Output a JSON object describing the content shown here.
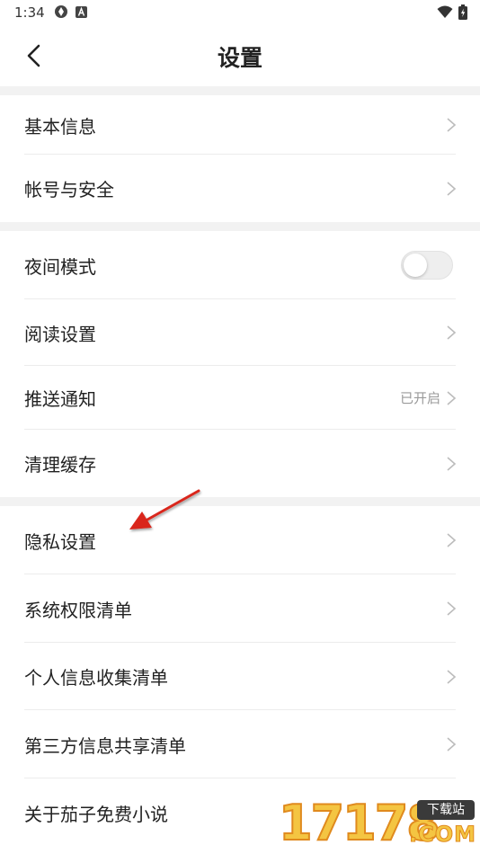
{
  "status_bar": {
    "time": "1:34",
    "icons": [
      "sync-icon",
      "a-badge-icon",
      "wifi-icon",
      "battery-icon"
    ]
  },
  "header": {
    "title": "设置",
    "back_icon": "chevron-left-icon"
  },
  "groups": [
    {
      "items": [
        {
          "label": "基本信息",
          "control": "chevron"
        },
        {
          "label": "帐号与安全",
          "control": "chevron"
        }
      ]
    },
    {
      "items": [
        {
          "label": "夜间模式",
          "control": "toggle",
          "toggle_on": false
        },
        {
          "label": "阅读设置",
          "control": "chevron"
        },
        {
          "label": "推送通知",
          "control": "chevron",
          "status": "已开启"
        },
        {
          "label": "清理缓存",
          "control": "chevron"
        }
      ]
    },
    {
      "items": [
        {
          "label": "隐私设置",
          "control": "chevron"
        },
        {
          "label": "系统权限清单",
          "control": "chevron"
        },
        {
          "label": "个人信息收集清单",
          "control": "chevron"
        },
        {
          "label": "第三方信息共享清单",
          "control": "chevron"
        },
        {
          "label": "关于茄子免费小说",
          "control": "chevron"
        }
      ]
    }
  ],
  "annotation": {
    "icon": "red-arrow-icon",
    "color": "#d9261c"
  },
  "watermark": {
    "digits": "17178",
    "badge": "下载站",
    "suffix": ".COM"
  },
  "colors": {
    "gap": "#f2f2f2",
    "divider": "#ececec",
    "text": "#222222",
    "muted": "#9a9a9a"
  }
}
